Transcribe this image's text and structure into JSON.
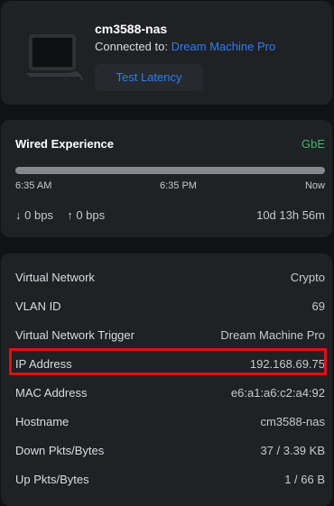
{
  "device": {
    "name": "cm3588-nas",
    "connected_label": "Connected to:",
    "connected_to": "Dream Machine Pro",
    "test_latency_label": "Test Latency",
    "thumbnail_icon": "laptop-device-icon"
  },
  "wired": {
    "title": "Wired Experience",
    "speed": "GbE",
    "timeline_ticks": [
      "6:35 AM",
      "6:35 PM",
      "Now"
    ],
    "download": "0 bps",
    "upload": "0 bps",
    "uptime": "10d 13h 56m",
    "speed_color": "#3db86b"
  },
  "details": [
    {
      "label": "Virtual Network",
      "value": "Crypto"
    },
    {
      "label": "VLAN ID",
      "value": "69"
    },
    {
      "label": "Virtual Network Trigger",
      "value": "Dream Machine Pro"
    },
    {
      "label": "IP Address",
      "value": "192.168.69.75"
    },
    {
      "label": "MAC Address",
      "value": "e6:a1:a6:c2:a4:92"
    },
    {
      "label": "Hostname",
      "value": "cm3588-nas"
    },
    {
      "label": "Down Pkts/Bytes",
      "value": "37 / 3.39 KB"
    },
    {
      "label": "Up Pkts/Bytes",
      "value": "1 / 66 B"
    }
  ],
  "colors": {
    "accent": "#2f7cf6",
    "highlight": "#e01010",
    "panel": "#1f2125",
    "background": "#111214"
  }
}
